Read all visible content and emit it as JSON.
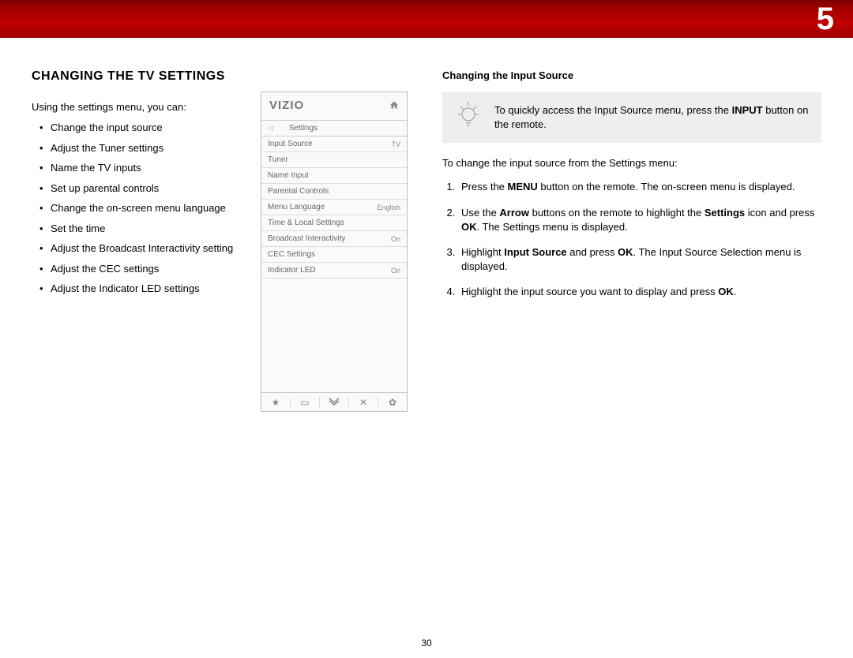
{
  "chapter": "5",
  "pageNumber": "30",
  "left": {
    "heading": "CHANGING THE TV SETTINGS",
    "intro": "Using the settings menu, you can:",
    "bullets": [
      "Change the input source",
      "Adjust the Tuner settings",
      "Name the TV inputs",
      "Set up parental controls",
      "Change the on-screen menu language",
      "Set the time",
      "Adjust the Broadcast Interactivity setting",
      "Adjust the CEC settings",
      "Adjust the Indicator LED settings"
    ]
  },
  "tv": {
    "logo": "VIZIO",
    "crumb": "Settings",
    "rows": [
      {
        "label": "Input Source",
        "value": "TV"
      },
      {
        "label": "Tuner",
        "value": ""
      },
      {
        "label": "Name Input",
        "value": ""
      },
      {
        "label": "Parental Controls",
        "value": ""
      },
      {
        "label": "Menu Language",
        "value": "English"
      },
      {
        "label": "Time & Local Settings",
        "value": ""
      },
      {
        "label": "Broadcast Interactivity",
        "value": "On"
      },
      {
        "label": "CEC Settings",
        "value": ""
      },
      {
        "label": "Indicator LED",
        "value": "On"
      }
    ]
  },
  "right": {
    "subheading": "Changing the Input Source",
    "tip_pre": "To quickly access the Input Source menu, press the ",
    "tip_bold": "INPUT",
    "tip_post": " button on the remote.",
    "lead": "To change the input source from the Settings menu:",
    "steps": {
      "s1a": "Press the ",
      "s1b": "MENU",
      "s1c": " button on the remote. The on-screen menu is displayed.",
      "s2a": "Use the ",
      "s2b": "Arrow",
      "s2c": " buttons on the remote to highlight the ",
      "s2d": "Settings",
      "s2e": " icon and press ",
      "s2f": "OK",
      "s2g": ". The Settings menu is displayed.",
      "s3a": "Highlight ",
      "s3b": "Input Source",
      "s3c": " and press ",
      "s3d": "OK",
      "s3e": ". The Input Source Selection menu is displayed.",
      "s4a": "Highlight the input source you want to display and press ",
      "s4b": "OK",
      "s4c": "."
    }
  }
}
